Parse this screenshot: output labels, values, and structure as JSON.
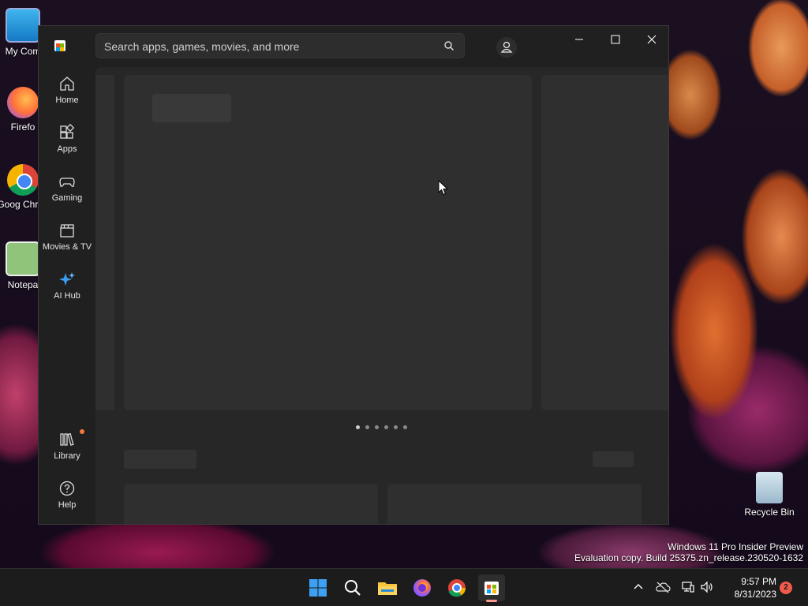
{
  "desktop": {
    "icons": [
      {
        "label": "My Com"
      },
      {
        "label": "Firefo"
      },
      {
        "label": "Goog Chron"
      },
      {
        "label": "Notepa"
      },
      {
        "label": "Recycle Bin"
      }
    ],
    "watermark": {
      "line1": "Windows 11 Pro Insider Preview",
      "line2": "Evaluation copy. Build 25375.zn_release.230520-1632"
    }
  },
  "store": {
    "search": {
      "placeholder": "Search apps, games, movies, and more"
    },
    "nav": [
      {
        "label": "Home",
        "icon": "home-icon"
      },
      {
        "label": "Apps",
        "icon": "apps-icon"
      },
      {
        "label": "Gaming",
        "icon": "gamepad-icon"
      },
      {
        "label": "Movies & TV",
        "icon": "clapperboard-icon"
      },
      {
        "label": "AI Hub",
        "icon": "sparkle-icon"
      },
      {
        "label": "Library",
        "icon": "library-icon"
      },
      {
        "label": "Help",
        "icon": "help-icon"
      }
    ],
    "carousel": {
      "pages": 6,
      "active": 0
    },
    "accent": "#0078d4"
  },
  "taskbar": {
    "clock": {
      "time": "9:57 PM",
      "date": "8/31/2023"
    },
    "notifications": "2",
    "colors": {
      "store_indicator": "#ff9a8a",
      "badge": "#f25a4a"
    }
  }
}
